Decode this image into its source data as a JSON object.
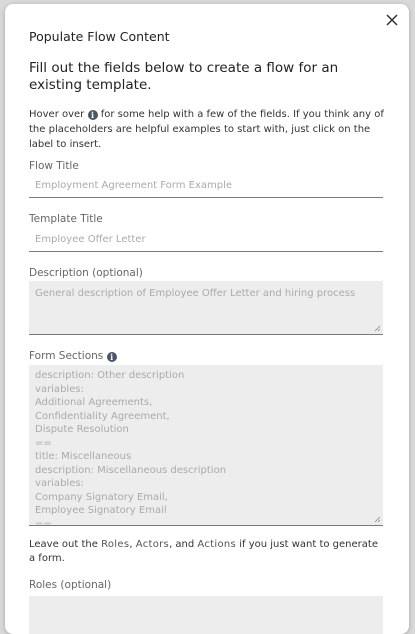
{
  "modal": {
    "title": "Populate Flow Content",
    "subtitle": "Fill out the fields below to create a flow for an existing template.",
    "help_before_icon": "Hover over",
    "help_after_icon": "for some help with a few of the fields. If you think any of the placeholders are helpful examples to start with, just click on the label to insert."
  },
  "fields": {
    "flow_title": {
      "label": "Flow Title",
      "placeholder": "Employment Agreement Form Example"
    },
    "template_title": {
      "label": "Template Title",
      "placeholder": "Employee Offer Letter"
    },
    "description": {
      "label": "Description (optional)",
      "placeholder": "General description of Employee Offer Letter and hiring process"
    },
    "form_sections": {
      "label": "Form Sections",
      "content": "description: Other description\nvariables:\nAdditional Agreements,\nConfidentiality Agreement,\nDispute Resolution\n==\ntitle: Miscellaneous\ndescription: Miscellaneous description\nvariables:\nCompany Signatory Email,\nEmployee Signatory Email\n=="
    },
    "roles": {
      "label": "Roles (optional)"
    }
  },
  "note": {
    "prefix": "Leave out the",
    "roles": "Roles",
    "sep1": ",",
    "actors": "Actors",
    "sep2": ", and",
    "actions": "Actions",
    "suffix": "if you just want to generate a form."
  },
  "icons": {
    "info": "info-icon",
    "close": "close-icon"
  }
}
